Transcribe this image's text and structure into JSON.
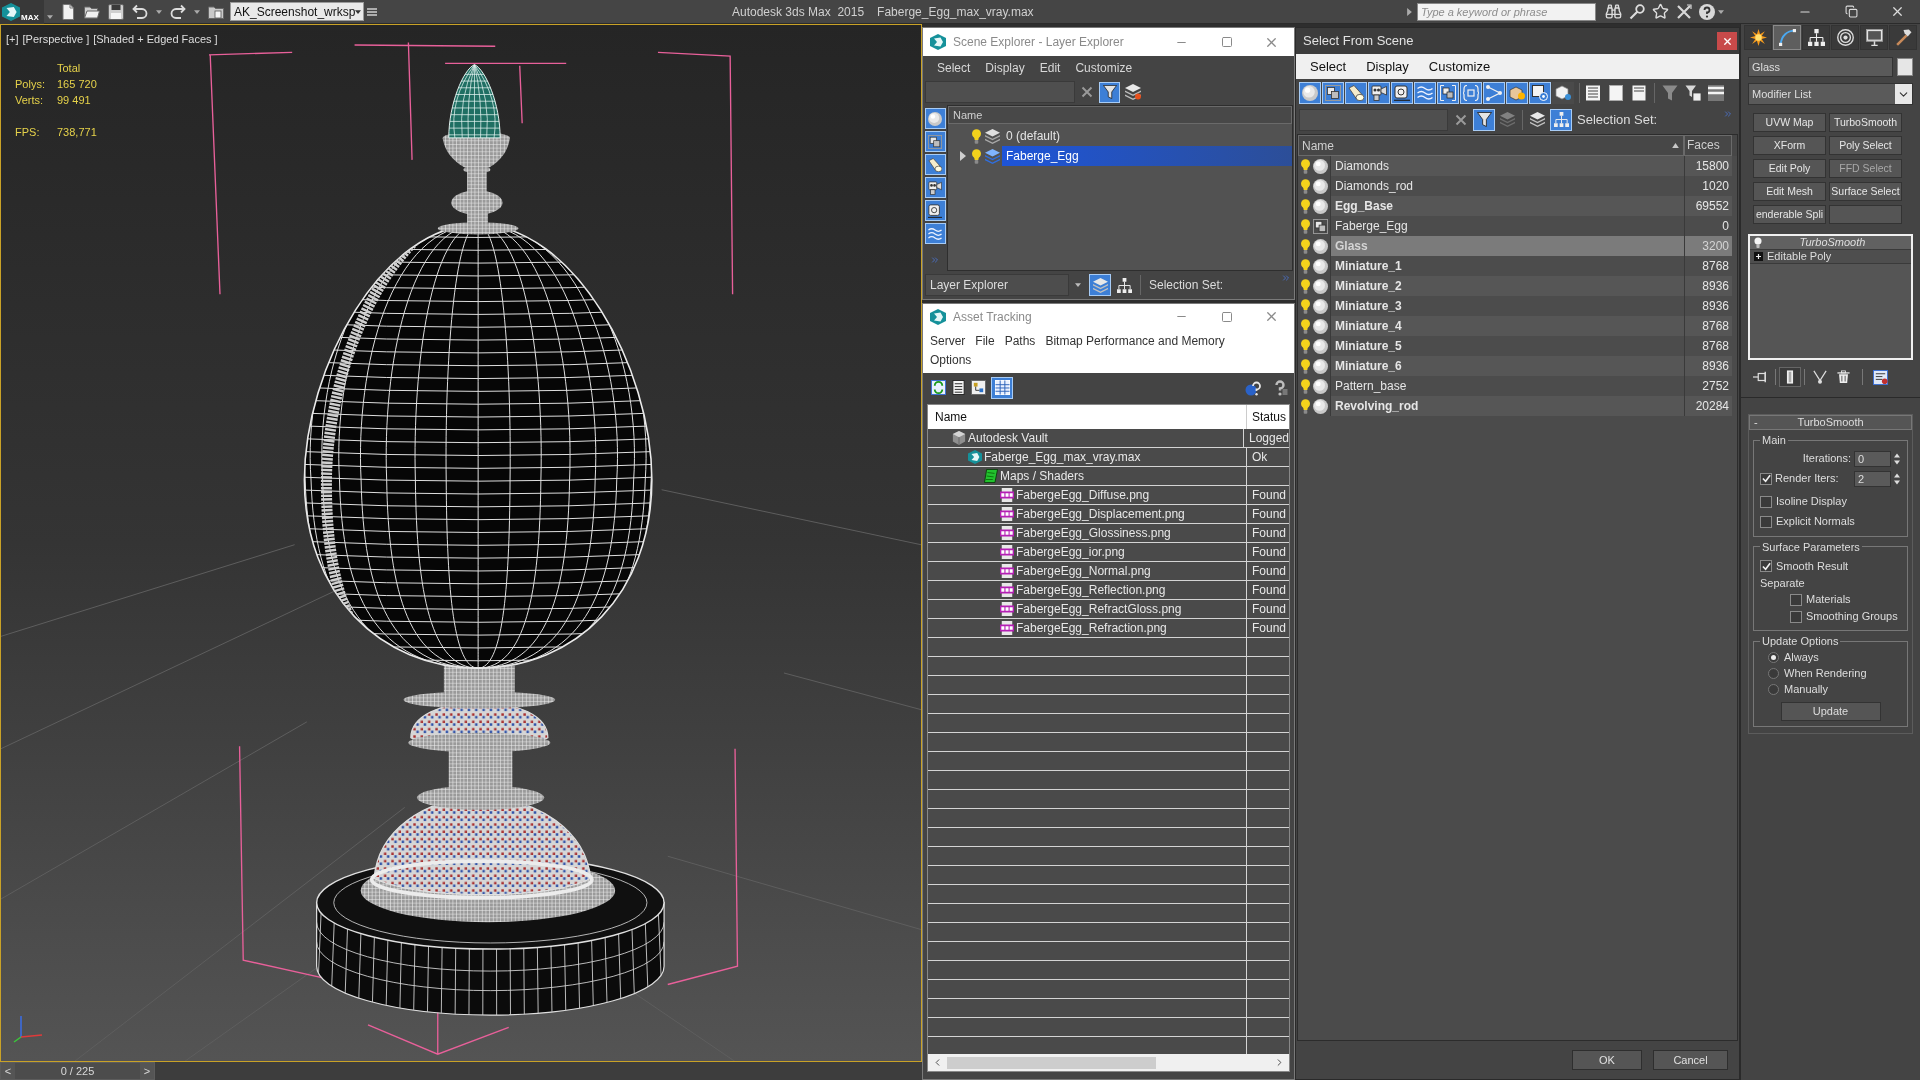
{
  "title_bar": {
    "app_button": "MAX",
    "workspace": "AK_Screenshot_wrksp",
    "app_title": "Autodesk 3ds Max  2015",
    "file_name": "Faberge_Egg_max_vray.max",
    "search": {
      "placeholder": "Type a keyword or phrase"
    }
  },
  "viewport": {
    "active": true,
    "labels": [
      "[+]",
      "[Perspective ]",
      "[Shaded + Edged Faces ]"
    ],
    "stats": {
      "heading": "Total",
      "rows": [
        {
          "label": "Polys:",
          "value": "165 720"
        },
        {
          "label": "Verts:",
          "value": "99 491"
        }
      ],
      "fps": {
        "label": "FPS:",
        "value": "738,771"
      }
    }
  },
  "time_slider": {
    "prev": "<",
    "reading": "0 / 225",
    "next": ">",
    "level": 0
  },
  "scene_explorer": {
    "title": "Scene Explorer - Layer Explorer",
    "menu": [
      "Select",
      "Display",
      "Edit",
      "Customize"
    ],
    "filters": [
      {
        "on": true
      },
      {
        "on": true
      },
      {
        "on": true
      },
      {
        "on": true
      },
      {
        "on": true
      },
      {
        "on": true
      }
    ],
    "column": "Name",
    "layers": [
      {
        "name": "0 (default)",
        "expandable": false,
        "current": false,
        "selected": false
      },
      {
        "name": "Faberge_Egg",
        "expandable": true,
        "current": true,
        "selected": true
      }
    ],
    "mode": "Layer Explorer",
    "selection_set": "Selection Set:"
  },
  "asset_tracking": {
    "title": "Asset Tracking",
    "menu": [
      "Server",
      "File",
      "Paths",
      "Bitmap Performance and Memory",
      "Options"
    ],
    "columns": [
      "Name",
      "Status"
    ],
    "assets": [
      {
        "name": "Autodesk Vault",
        "status": "Logged",
        "kind": "vault",
        "children": [
          {
            "name": "Faberge_Egg_max_vray.max",
            "status": "Ok",
            "kind": "scene",
            "children": [
              {
                "name": "Maps / Shaders",
                "kind": "folder",
                "children": [
                  {
                    "name": "FabergeEgg_Diffuse.png",
                    "status": "Found",
                    "kind": "png"
                  },
                  {
                    "name": "FabergeEgg_Displacement.png",
                    "status": "Found",
                    "kind": "png"
                  },
                  {
                    "name": "FabergeEgg_Glossiness.png",
                    "status": "Found",
                    "kind": "png"
                  },
                  {
                    "name": "FabergeEgg_ior.png",
                    "status": "Found",
                    "kind": "png"
                  },
                  {
                    "name": "FabergeEgg_Normal.png",
                    "status": "Found",
                    "kind": "png"
                  },
                  {
                    "name": "FabergeEgg_Reflection.png",
                    "status": "Found",
                    "kind": "png"
                  },
                  {
                    "name": "FabergeEgg_RefractGloss.png",
                    "status": "Found",
                    "kind": "png"
                  },
                  {
                    "name": "FabergeEgg_Refraction.png",
                    "status": "Found",
                    "kind": "png"
                  }
                ]
              }
            ]
          }
        ]
      }
    ]
  },
  "select_from_scene": {
    "title": "Select From Scene",
    "menu": [
      "Select",
      "Display",
      "Customize"
    ],
    "filters": [
      {
        "on": true
      },
      {
        "on": true
      },
      {
        "on": true
      },
      {
        "on": true
      },
      {
        "on": true
      },
      {
        "on": true
      },
      {
        "on": true
      },
      {
        "on": true
      },
      {
        "on": true
      },
      {
        "on": true
      },
      {
        "on": true
      },
      {
        "on": false
      }
    ],
    "selection_set": "Selection Set:",
    "columns": [
      "Name",
      "Faces"
    ],
    "objects": [
      {
        "name": "Diamonds",
        "faces": "15800",
        "kind": "geometry",
        "bold": false,
        "selected": false
      },
      {
        "name": "Diamonds_rod",
        "faces": "1020",
        "kind": "geometry",
        "bold": false,
        "selected": false
      },
      {
        "name": "Egg_Base",
        "faces": "69552",
        "kind": "geometry",
        "bold": true,
        "selected": false
      },
      {
        "name": "Faberge_Egg",
        "faces": "0",
        "kind": "group",
        "bold": false,
        "selected": false
      },
      {
        "name": "Glass",
        "faces": "3200",
        "kind": "geometry",
        "bold": true,
        "selected": true
      },
      {
        "name": "Miniature_1",
        "faces": "8768",
        "kind": "geometry",
        "bold": true,
        "selected": false
      },
      {
        "name": "Miniature_2",
        "faces": "8936",
        "kind": "geometry",
        "bold": true,
        "selected": false
      },
      {
        "name": "Miniature_3",
        "faces": "8936",
        "kind": "geometry",
        "bold": true,
        "selected": false
      },
      {
        "name": "Miniature_4",
        "faces": "8768",
        "kind": "geometry",
        "bold": true,
        "selected": false
      },
      {
        "name": "Miniature_5",
        "faces": "8768",
        "kind": "geometry",
        "bold": true,
        "selected": false
      },
      {
        "name": "Miniature_6",
        "faces": "8936",
        "kind": "geometry",
        "bold": true,
        "selected": false
      },
      {
        "name": "Pattern_base",
        "faces": "2752",
        "kind": "geometry",
        "bold": false,
        "selected": false
      },
      {
        "name": "Revolving_rod",
        "faces": "20284",
        "kind": "geometry",
        "bold": true,
        "selected": false
      }
    ],
    "buttons": [
      "OK",
      "Cancel"
    ]
  },
  "command_panel": {
    "tabs": [
      {
        "kind": "create",
        "selected": false
      },
      {
        "kind": "modify",
        "selected": true
      },
      {
        "kind": "hierarchy",
        "selected": false
      },
      {
        "kind": "motion",
        "selected": false
      },
      {
        "kind": "display",
        "selected": false
      },
      {
        "kind": "utilities",
        "selected": false
      }
    ],
    "object_name": "Glass",
    "modifier_list": "Modifier List",
    "modifier_buttons": [
      {
        "label": "UVW Map",
        "disabled": false
      },
      {
        "label": "TurboSmooth",
        "disabled": false
      },
      {
        "label": "XForm",
        "disabled": false
      },
      {
        "label": "Poly Select",
        "disabled": false
      },
      {
        "label": "Edit Poly",
        "disabled": false
      },
      {
        "label": "FFD Select",
        "disabled": true
      },
      {
        "label": "Edit Mesh",
        "disabled": false
      },
      {
        "label": "Surface Select",
        "disabled": false
      },
      {
        "label": "enderable Spli",
        "disabled": false
      }
    ],
    "stack": [
      {
        "name": "TurboSmooth",
        "kind": "modifier",
        "selected": true
      },
      {
        "name": "Editable Poly",
        "kind": "base_object",
        "selected": false
      }
    ],
    "rollout": {
      "collapse_sign": "-",
      "title": "TurboSmooth",
      "groups": [
        {
          "title": "Main",
          "controls": [
            {
              "kind": "spinner",
              "label": "Iterations:",
              "value": "0"
            },
            {
              "kind": "check_spinner",
              "label": "Render Iters:",
              "value": "2",
              "checked": true
            },
            {
              "kind": "checkbox",
              "label": "Isoline Display",
              "checked": false
            },
            {
              "kind": "checkbox",
              "label": "Explicit Normals",
              "checked": false
            }
          ]
        },
        {
          "title": "Surface Parameters",
          "controls": [
            {
              "kind": "checkbox",
              "label": "Smooth Result",
              "checked": true
            },
            {
              "kind": "label",
              "label": "Separate"
            },
            {
              "kind": "sub_checkbox",
              "label": "Materials",
              "checked": false
            },
            {
              "kind": "sub_checkbox",
              "label": "Smoothing Groups",
              "checked": false
            }
          ]
        },
        {
          "title": "Update Options",
          "controls": [
            {
              "kind": "radio",
              "label": "Always",
              "selected": true
            },
            {
              "kind": "radio",
              "label": "When Rendering",
              "selected": false
            },
            {
              "kind": "radio",
              "label": "Manually",
              "selected": false
            },
            {
              "kind": "button",
              "label": "Update"
            }
          ]
        }
      ]
    }
  }
}
